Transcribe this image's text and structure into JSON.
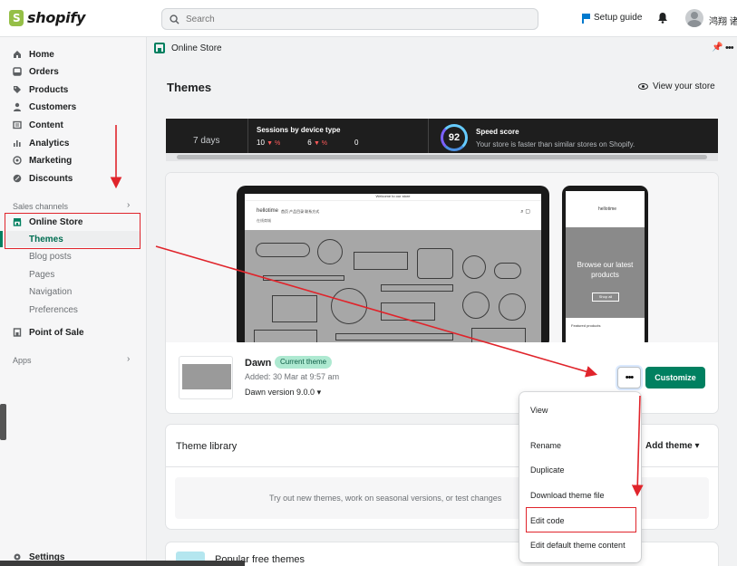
{
  "topbar": {
    "logo": "shopify",
    "search_placeholder": "Search",
    "setup_guide": "Setup guide",
    "username": "鸿翔 诸"
  },
  "sidebar": {
    "items": [
      {
        "label": "Home",
        "icon": "home-icon"
      },
      {
        "label": "Orders",
        "icon": "orders-icon"
      },
      {
        "label": "Products",
        "icon": "tag-icon"
      },
      {
        "label": "Customers",
        "icon": "person-icon"
      },
      {
        "label": "Content",
        "icon": "content-icon"
      },
      {
        "label": "Analytics",
        "icon": "bar-chart-icon"
      },
      {
        "label": "Marketing",
        "icon": "target-icon"
      },
      {
        "label": "Discounts",
        "icon": "discount-icon"
      }
    ],
    "sales_channels_label": "Sales channels",
    "online_store": "Online Store",
    "online_store_sub": [
      "Themes",
      "Blog posts",
      "Pages",
      "Navigation",
      "Preferences"
    ],
    "point_of_sale": "Point of Sale",
    "apps_label": "Apps",
    "settings": "Settings"
  },
  "breadcrumb": "Online Store",
  "page_title": "Themes",
  "view_store": "View your store",
  "stats": {
    "days": "7 days",
    "sessions_title": "Sessions by device type",
    "sessions_values": [
      "10",
      "6",
      "0"
    ],
    "speed_score": "92",
    "speed_title": "Speed score",
    "speed_desc": "Your store is faster than similar stores on Shopify."
  },
  "preview": {
    "announcement": "Welcome to our store",
    "store_name": "hellotime",
    "store_sub": "在线商城",
    "nav": "首页    产品目录    联系方式",
    "phone_hero": "Browse our latest products",
    "phone_btn": "Shop all",
    "phone_featured": "Featured products"
  },
  "current_theme": {
    "name": "Dawn",
    "badge": "Current theme",
    "added": "Added: 30 Mar at 9:57 am",
    "version": "Dawn version 9.0.0",
    "more_label": "•••",
    "customize_label": "Customize"
  },
  "library": {
    "title": "Theme library",
    "add_theme": "Add theme",
    "empty_text": "Try out new themes, work on seasonal versions, or test changes"
  },
  "popular": {
    "title": "Popular free themes"
  },
  "menu": {
    "items": [
      "View",
      "Rename",
      "Duplicate",
      "Download theme file",
      "Edit code",
      "Edit default theme content"
    ]
  },
  "colors": {
    "brand": "#008060",
    "annotation": "#e0242b",
    "badge_bg": "#aee9d1"
  }
}
